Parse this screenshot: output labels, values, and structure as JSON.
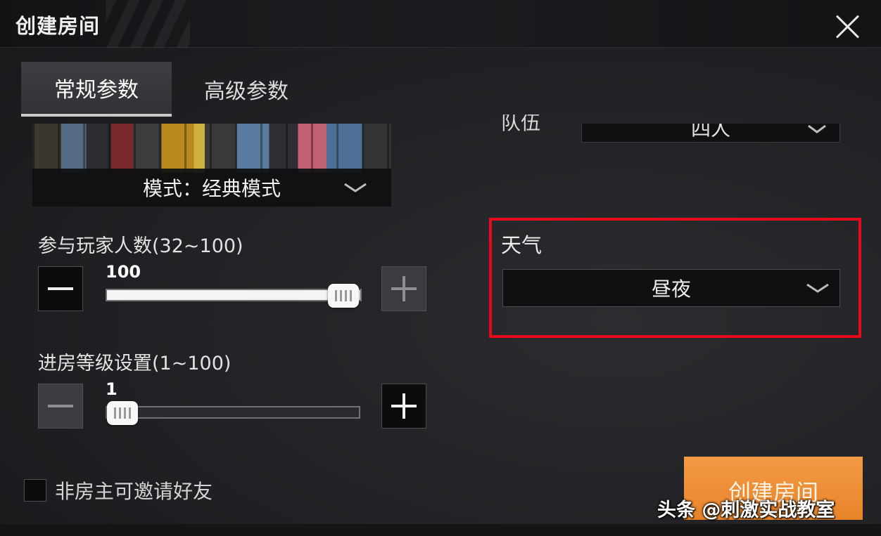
{
  "window": {
    "title": "创建房间",
    "close_icon": "close-icon"
  },
  "tabs": [
    {
      "label": "常规参数",
      "active": true
    },
    {
      "label": "高级参数",
      "active": false
    }
  ],
  "mode": {
    "label": "模式：经典模式",
    "icon": "chevron-down-icon"
  },
  "team": {
    "label": "队伍",
    "value": "四人",
    "icon": "chevron-down-icon"
  },
  "players": {
    "label": "参与玩家人数(32~100)",
    "value": "100",
    "fill_fraction": 1.0,
    "minus_icon": "minus-icon",
    "plus_icon": "plus-icon"
  },
  "level": {
    "label": "进房等级设置(1~100)",
    "value": "1",
    "fill_fraction": 0.0,
    "minus_icon": "minus-icon",
    "plus_icon": "plus-icon"
  },
  "weather": {
    "label": "天气",
    "value": "昼夜",
    "icon": "chevron-down-icon",
    "highlight_color": "#e8091c"
  },
  "invite": {
    "label": "非房主可邀请好友",
    "checked": false
  },
  "create_button": {
    "label": "创建房间",
    "color": "#f0913c"
  },
  "watermark": "头条 @刺激实战教室"
}
